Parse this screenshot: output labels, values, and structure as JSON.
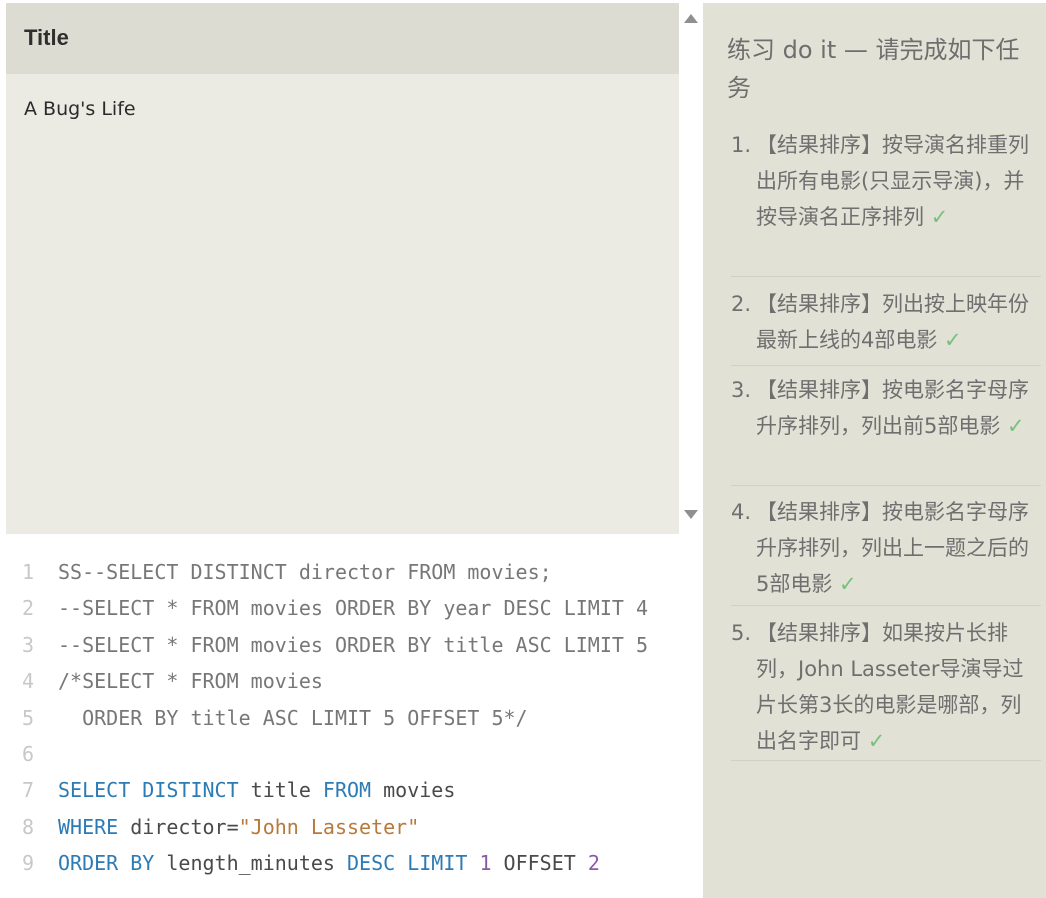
{
  "results": {
    "column_header": "Title",
    "rows": [
      "A Bug's Life"
    ]
  },
  "editor": {
    "lines": [
      {
        "num": "1",
        "segments": [
          {
            "t": "SS--SELECT DISTINCT director FROM movies;",
            "c": "plain-gray"
          }
        ]
      },
      {
        "num": "2",
        "segments": [
          {
            "t": "--SELECT * FROM movies ORDER BY year DESC LIMIT 4",
            "c": "plain-gray"
          }
        ]
      },
      {
        "num": "3",
        "segments": [
          {
            "t": "--SELECT * FROM movies ORDER BY title ASC LIMIT 5",
            "c": "plain-gray"
          }
        ]
      },
      {
        "num": "4",
        "segments": [
          {
            "t": "/*SELECT * FROM movies",
            "c": "plain-gray"
          }
        ]
      },
      {
        "num": "5",
        "segments": [
          {
            "t": "  ORDER BY title ASC LIMIT 5 OFFSET 5*/",
            "c": "plain-gray"
          }
        ]
      },
      {
        "num": "6",
        "segments": []
      },
      {
        "num": "7",
        "segments": [
          {
            "t": "SELECT DISTINCT",
            "c": "kw"
          },
          {
            "t": " title ",
            "c": "plain"
          },
          {
            "t": "FROM",
            "c": "kw"
          },
          {
            "t": " movies",
            "c": "plain"
          }
        ]
      },
      {
        "num": "8",
        "segments": [
          {
            "t": "WHERE",
            "c": "kw"
          },
          {
            "t": " director=",
            "c": "plain"
          },
          {
            "t": "\"John Lasseter\"",
            "c": "str"
          }
        ]
      },
      {
        "num": "9",
        "segments": [
          {
            "t": "ORDER BY",
            "c": "kw"
          },
          {
            "t": " length_minutes ",
            "c": "plain"
          },
          {
            "t": "DESC LIMIT",
            "c": "kw"
          },
          {
            "t": " ",
            "c": "plain"
          },
          {
            "t": "1",
            "c": "num"
          },
          {
            "t": " OFFSET ",
            "c": "plain"
          },
          {
            "t": "2",
            "c": "num"
          }
        ]
      }
    ]
  },
  "panel": {
    "title": "练习 do it — 请完成如下任务",
    "check_mark": "✓",
    "tasks": [
      {
        "num": "1.",
        "text": "【结果排序】按导演名排重列出所有电影(只显示导演)，并按导演名正序排列"
      },
      {
        "num": "2.",
        "text": "【结果排序】列出按上映年份最新上线的4部电影"
      },
      {
        "num": "3.",
        "text": "【结果排序】按电影名字母序升序排列，列出前5部电影"
      },
      {
        "num": "4.",
        "text": "【结果排序】按电影名字母序升序排列，列出上一题之后的5部电影"
      },
      {
        "num": "5.",
        "text": "【结果排序】如果按片长排列，John Lasseter导演导过片长第3长的电影是哪部，列出名字即可"
      }
    ]
  }
}
